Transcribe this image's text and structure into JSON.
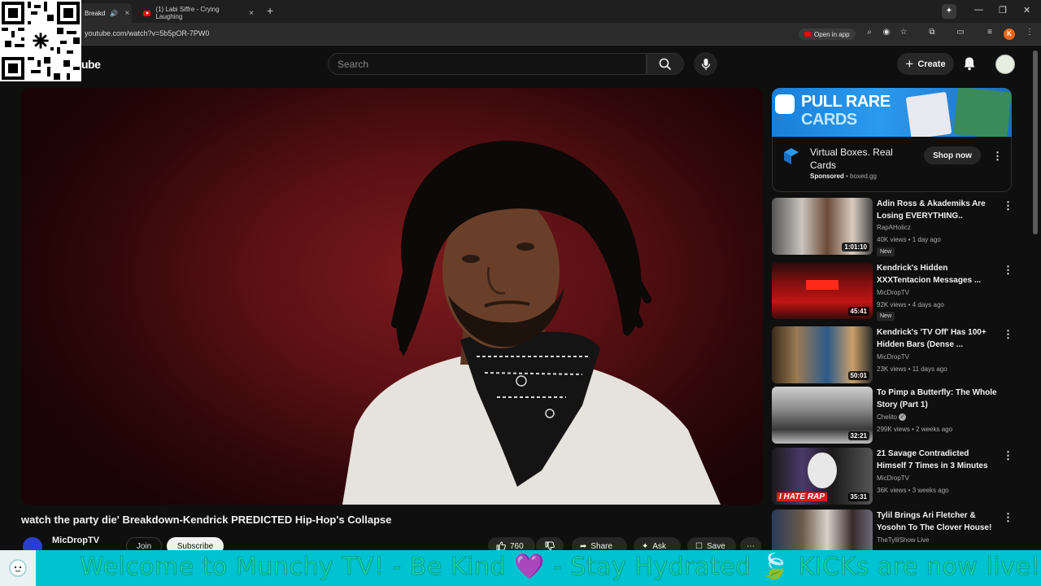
{
  "browser": {
    "tabs": [
      {
        "label": "Breakd",
        "active": true
      },
      {
        "label": "(1) Labi Siffre - Crying Laughing",
        "active": false
      }
    ],
    "url": "youtube.com/watch?v=5b5pOR-7PW0",
    "open_in_app": "Open in app",
    "profile_initial": "K"
  },
  "youtube": {
    "logo_text": "ube",
    "search_placeholder": "Search",
    "create_label": "Create"
  },
  "video": {
    "title": "watch the party die' Breakdown-Kendrick PREDICTED Hip-Hop's Collapse",
    "channel": "MicDropTV",
    "join_label": "Join",
    "subscribe_label": "Subscribe",
    "likes": "760",
    "share_label": "Share",
    "ask_label": "Ask",
    "save_label": "Save"
  },
  "ad": {
    "banner_line1": "PULL RARE",
    "banner_line2": "CARDS",
    "title": "Virtual Boxes. Real Cards",
    "sponsored": "Sponsored",
    "domain": "boxed.gg",
    "cta": "Shop now"
  },
  "recommendations": [
    {
      "title": "Adin Ross & Akademiks Are Losing EVERYTHING..",
      "channel": "RapAHolicz",
      "meta": "40K views • 1 day ago",
      "duration": "1:01:10",
      "badge": "New",
      "verified": false
    },
    {
      "title": "Kendrick's Hidden XXXTentacion Messages ...",
      "channel": "MicDropTV",
      "meta": "92K views • 4 days ago",
      "duration": "45:41",
      "badge": "New",
      "verified": false
    },
    {
      "title": "Kendrick's 'TV Off' Has 100+ Hidden Bars (Dense ...",
      "channel": "MicDropTV",
      "meta": "23K views • 11 days ago",
      "duration": "50:01",
      "badge": "",
      "verified": false
    },
    {
      "title": "To Pimp a Butterfly: The Whole Story (Part 1)",
      "channel": "Chelito",
      "meta": "299K views • 2 weeks ago",
      "duration": "32:21",
      "badge": "",
      "verified": true
    },
    {
      "title": "21 Savage Contradicted Himself 7 Times in 3 Minutes",
      "channel": "MicDropTV",
      "meta": "36K views • 3 weeks ago",
      "duration": "35:31",
      "badge": "",
      "verified": false,
      "thumb_caption": "I HATE RAP"
    },
    {
      "title": "Tylil Brings Ari Fletcher & Yosohn To The Clover House!",
      "channel": "TheTylilShow Live",
      "meta": "",
      "duration": "",
      "badge": "",
      "verified": false
    }
  ],
  "ticker": {
    "text": "Welcome to Munchy TV!  - Be Kind 💜  - Stay Hydrated 🍃  KICKs are now live! 🔔"
  },
  "colors": {
    "yt_red": "#ff0000",
    "ticker_bg": "#00c2d1",
    "ticker_text": "#0cd6a0",
    "profile": "#e8671e"
  }
}
